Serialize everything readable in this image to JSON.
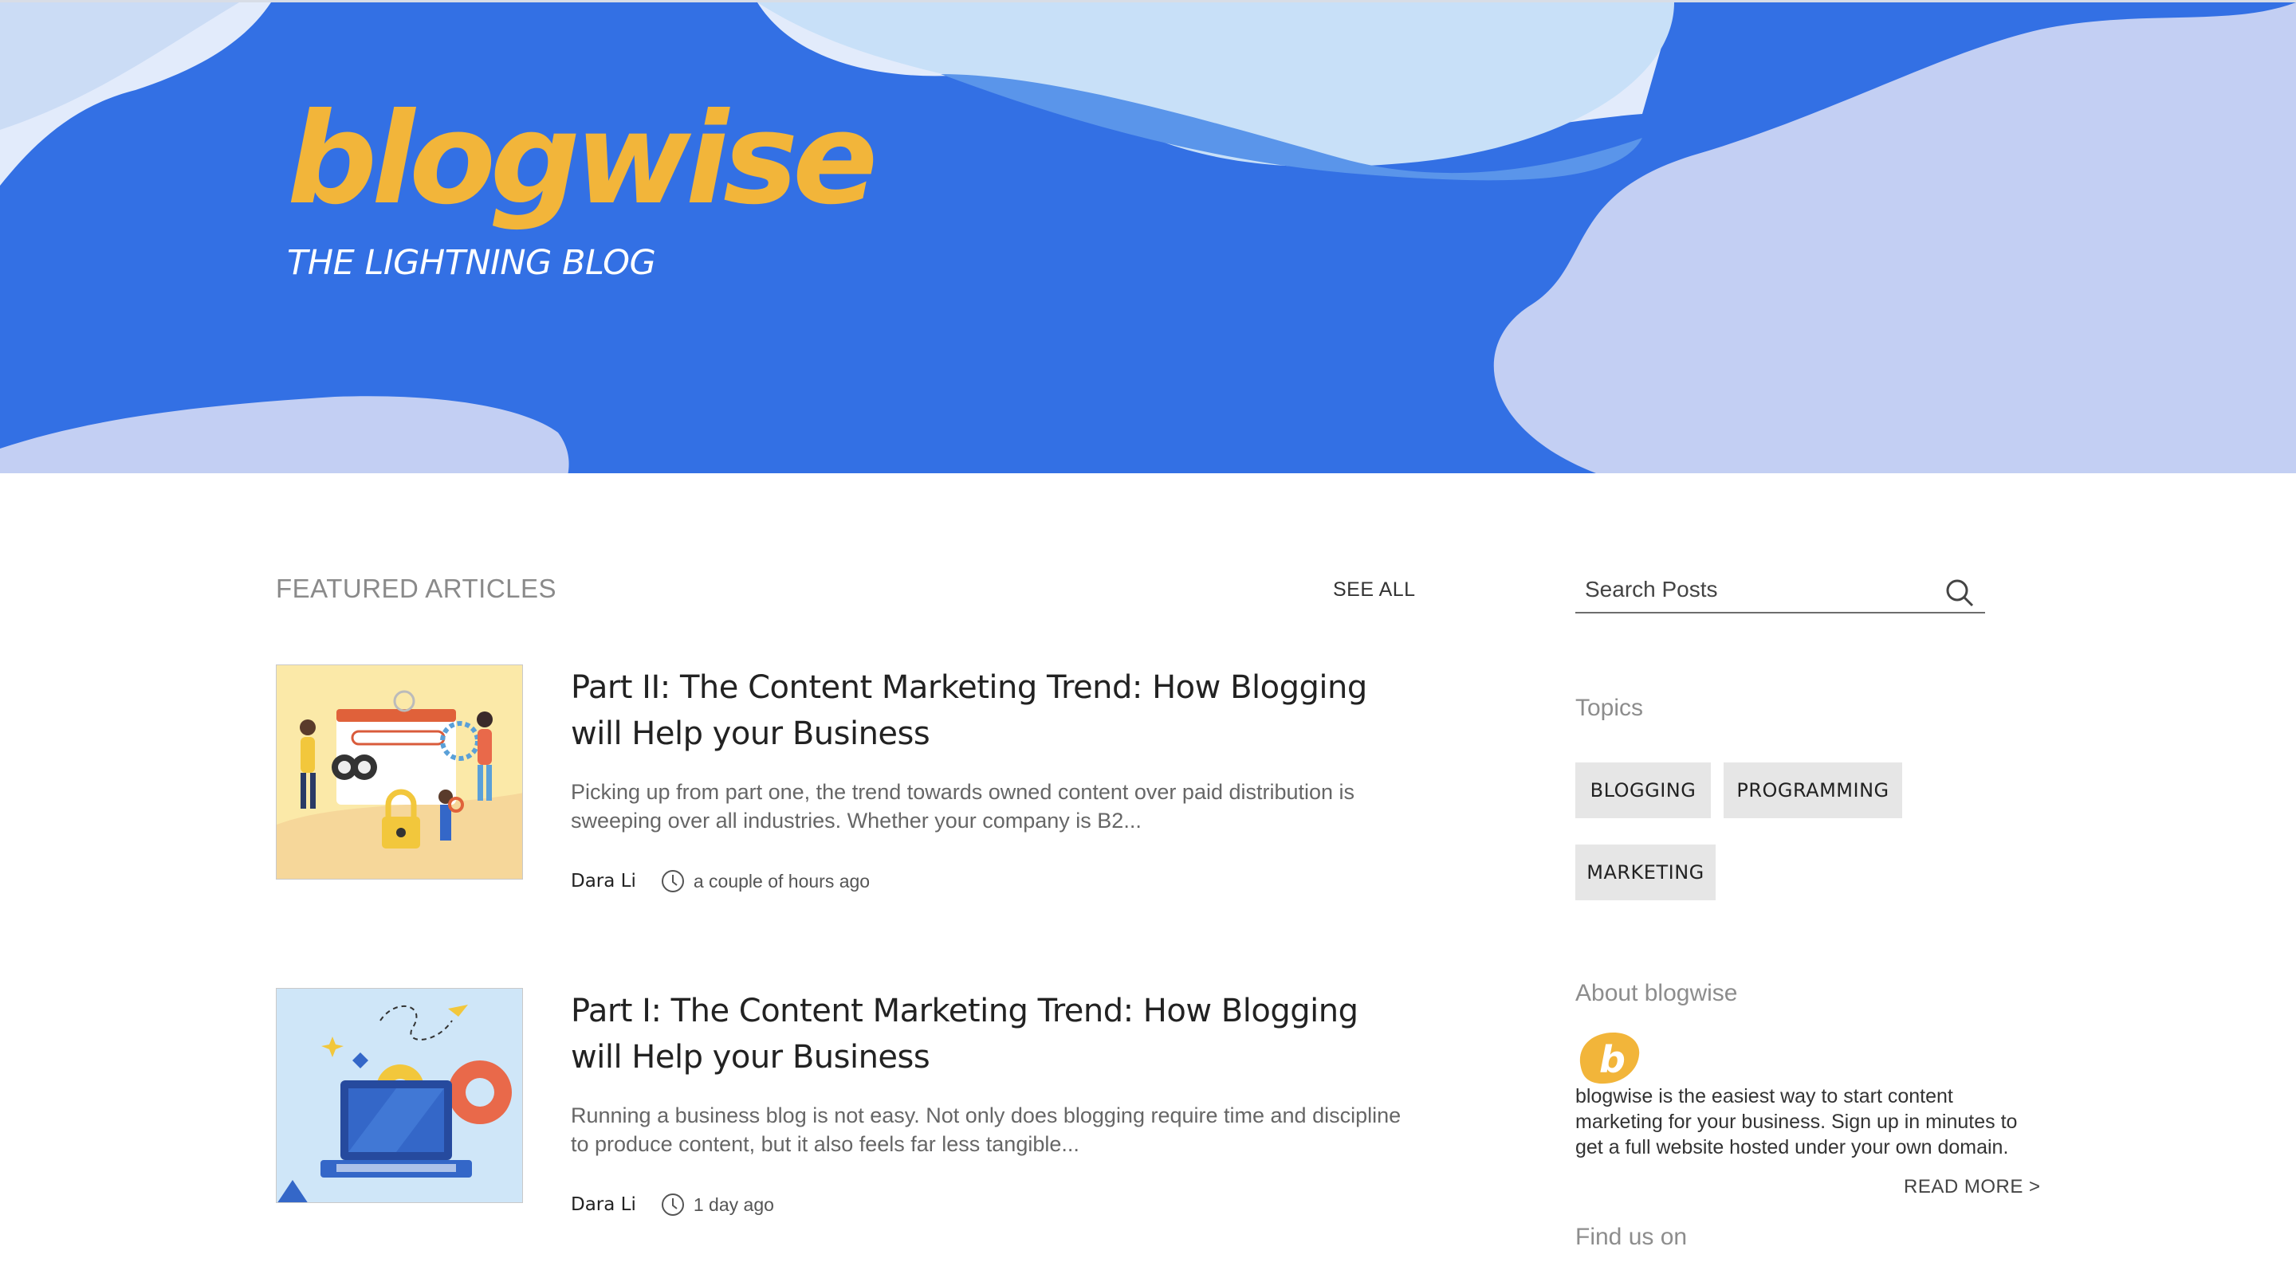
{
  "header": {
    "logo_text": "blogwise",
    "tagline": "THE LIGHTNING BLOG"
  },
  "featured": {
    "heading": "FEATURED ARTICLES",
    "see_all": "SEE ALL",
    "articles": [
      {
        "title": "Part II: The Content Marketing Trend: How Blogging will Help your Business",
        "excerpt": "Picking up from part one, the trend towards owned content over paid distribution is sweeping over all industries. Whether your company is B2...",
        "author": "Dara Li",
        "time": "a couple of hours ago"
      },
      {
        "title": "Part I: The Content Marketing Trend: How Blogging will Help your Business",
        "excerpt": "Running a business blog is not easy. Not only does blogging require time and discipline to produce content, but it also feels far less tangible...",
        "author": "Dara Li",
        "time": "1 day ago"
      }
    ]
  },
  "sidebar": {
    "search_placeholder": "Search Posts",
    "topics_heading": "Topics",
    "topics": [
      "BLOGGING",
      "PROGRAMMING",
      "MARKETING"
    ],
    "about_heading": "About blogwise",
    "about_text": "blogwise is the easiest way to start content marketing for your business. Sign up in minutes to get a full website hosted under your own domain.",
    "read_more": "READ MORE >",
    "find_us": "Find us on"
  },
  "colors": {
    "hero_blue": "#3370e4",
    "brand_yellow": "#f2b53a",
    "tag_bg": "#e6e6e6"
  },
  "icons": [
    "search-icon",
    "clock-icon",
    "blogwise-logo-icon"
  ]
}
